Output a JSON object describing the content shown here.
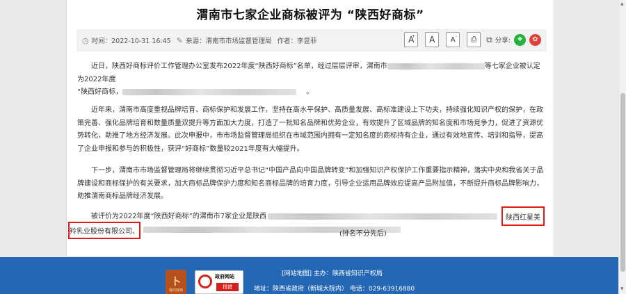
{
  "article": {
    "title": "渭南市七家企业商标被评为 “陕西好商标”",
    "meta": {
      "time": "时间：2022-10-31 16:45",
      "source": "来源：渭南市市场监督管理局",
      "author": "作者：李昱菲"
    },
    "tools": {
      "font_large": "A",
      "font_medium": "A",
      "font_small": "A",
      "share_label": "分享:",
      "icons": [
        "clock-icon",
        "pen-icon",
        "print-icon",
        "share-icon",
        "wechat-icon",
        "weibo-icon"
      ]
    },
    "paragraphs": {
      "p1a": "近日，陕西好商标评价工作管理办公室发布2022年度“陕西好商标”名单，经过层层评审，渭南市",
      "p1b": "等七家企业被认定为2022年度",
      "p1c": "“陕西好商标，",
      "p1d": "。",
      "p2": "近年来，渭南市高度重视品牌培育、商标保护和发展工作，坚持在高水平保护、高质量发展、高标准建设上下功夫，持续强化知识产权的保护，在政策完善、强化品牌培育和数量质量双提升等方面加大力度，打造了一批知名品牌和优势企业，有效提升了区域品牌的知名度和市场竞争力，促进了资源优势转化，助推了地方经济发展。此次申报中，市市场监督管理局组织在市域范围内拥有一定知名度的商标持有企业，通过有效地宣传、培训和指导，提高了企业申报和参与的积极性，获评“好商标”数量较2021年度有大幅提升。",
      "p3": "下一步，渭南市市场监督管理局将继续贯彻习近平总书记“中国产品向中国品牌转变”和加强知识产权保护工作重要指示精神，落实中央和我省关于品牌建设和商标保护的有关要求，加大商标品牌保护力度和知名商标品牌的培育力度，引导企业运用品牌效应提高产品附加值，不断提升商标品牌影响力，助推渭南商标品牌经济发展。",
      "p4a": "被评价为2022年度“陕西好商标”的渭南市7家企业是陕西",
      "p4_hl1": "陕西红星美",
      "p4_hl2": "羚乳业股份有限公司、",
      "p4_order": "(排名不分先后)"
    }
  },
  "footer": {
    "logo1_text": "我的陕西",
    "logo2_title": "政府网站",
    "logo2_button": "找错",
    "line1": "[网站地图]  主办：陕西省知识产权局",
    "line2": "地址：陕西省政府（新城大院内） 电话：029-63916880"
  },
  "colors": {
    "highlight_border": "#e0191b",
    "footer_bg": "#2467b4",
    "wechat": "#24b33a",
    "weibo": "#e0403a"
  }
}
